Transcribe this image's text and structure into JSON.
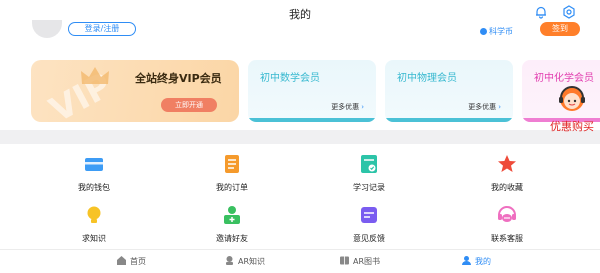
{
  "header": {
    "title": "我的"
  },
  "profile": {
    "login_label": "登录/注册",
    "coin_label": "科学币",
    "sign_label": "签到"
  },
  "vip_card": {
    "watermark": "VIP",
    "title": "全站终身VIP会员",
    "button_label": "立即开通"
  },
  "subject_cards": [
    {
      "name": "初中数学会员",
      "more_label": "更多优惠"
    },
    {
      "name": "初中物理会员",
      "more_label": "更多优惠"
    },
    {
      "name": "初中化学会员"
    }
  ],
  "assistant": {
    "label": "优惠购买"
  },
  "grid": [
    {
      "label": "我的钱包",
      "icon": "wallet-icon",
      "color": "#3d9cf5"
    },
    {
      "label": "我的订单",
      "icon": "order-icon",
      "color": "#f59a2c"
    },
    {
      "label": "学习记录",
      "icon": "study-record-icon",
      "color": "#2cc4a8"
    },
    {
      "label": "我的收藏",
      "icon": "star-icon",
      "color": "#ee4b3a"
    },
    {
      "label": "求知识",
      "icon": "bulb-icon",
      "color": "#f7c326"
    },
    {
      "label": "邀请好友",
      "icon": "invite-icon",
      "color": "#39c060"
    },
    {
      "label": "意见反馈",
      "icon": "feedback-icon",
      "color": "#7a5cf0"
    },
    {
      "label": "联系客服",
      "icon": "service-icon",
      "color": "#ef6fc0"
    }
  ],
  "nav": [
    {
      "label": "首页",
      "icon": "home-icon"
    },
    {
      "label": "AR知识",
      "icon": "ar-knowledge-icon"
    },
    {
      "label": "AR图书",
      "icon": "ar-book-icon"
    },
    {
      "label": "我的",
      "icon": "user-icon",
      "active": true
    }
  ],
  "colors": {
    "accent": "#2f8df5",
    "orange": "#ff7f2a",
    "red_label": "#e02424"
  }
}
